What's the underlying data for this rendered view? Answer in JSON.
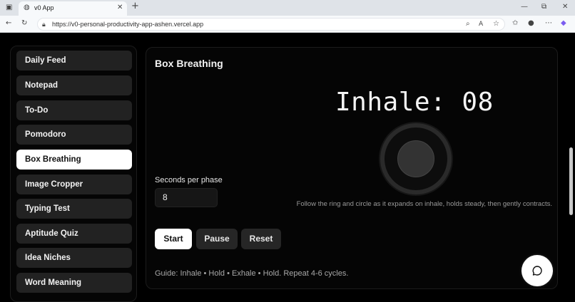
{
  "browser": {
    "tab_title": "v0 App",
    "url": "https://v0-personal-productivity-app-ashen.vercel.app"
  },
  "sidebar": {
    "items": [
      {
        "label": "Daily Feed",
        "active": false
      },
      {
        "label": "Notepad",
        "active": false
      },
      {
        "label": "To-Do",
        "active": false
      },
      {
        "label": "Pomodoro",
        "active": false
      },
      {
        "label": "Box Breathing",
        "active": true
      },
      {
        "label": "Image Cropper",
        "active": false
      },
      {
        "label": "Typing Test",
        "active": false
      },
      {
        "label": "Aptitude Quiz",
        "active": false
      },
      {
        "label": "Idea Niches",
        "active": false
      },
      {
        "label": "Word Meaning",
        "active": false
      }
    ]
  },
  "main": {
    "title": "Box Breathing",
    "phase_display": "Inhale: 08",
    "seconds_label": "Seconds per phase",
    "seconds_value": "8",
    "hint": "Follow the ring and circle as it expands on inhale, holds steady, then gently contracts.",
    "buttons": {
      "start": "Start",
      "pause": "Pause",
      "reset": "Reset"
    },
    "guide": "Guide: Inhale • Hold • Exhale • Hold. Repeat 4-6 cycles."
  },
  "icons": {
    "fab": "chat-bubble-icon"
  }
}
